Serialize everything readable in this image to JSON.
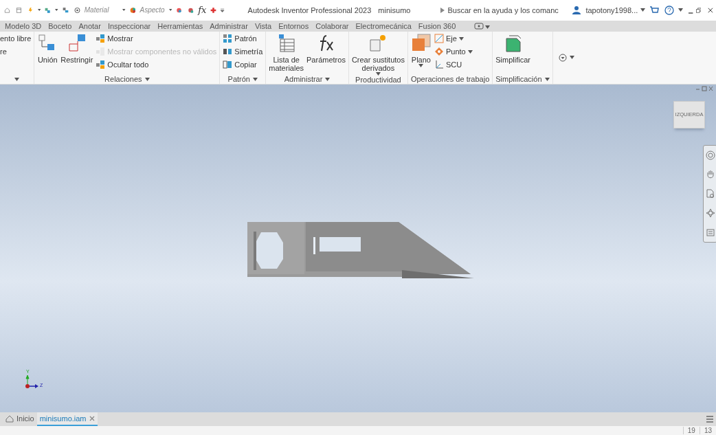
{
  "quick_access": {
    "material": "Material",
    "appearance": "Aspecto",
    "formula": "fx"
  },
  "window": {
    "title": "Autodesk Inventor Professional 2023",
    "document": "minisumo",
    "search": {
      "placeholder": "Buscar en la ayuda y los comanc"
    },
    "user": "tapotony1998..."
  },
  "ribbon_tabs": [
    {
      "label": "Modelo 3D"
    },
    {
      "label": "Boceto"
    },
    {
      "label": "Anotar"
    },
    {
      "label": "Inspeccionar"
    },
    {
      "label": "Herramientas"
    },
    {
      "label": "Administrar"
    },
    {
      "label": "Vista"
    },
    {
      "label": "Entornos"
    },
    {
      "label": "Colaborar"
    },
    {
      "label": "Electromecánica"
    },
    {
      "label": "Fusion 360"
    }
  ],
  "ribbon_panels": [
    {
      "menu": true,
      "commands": [
        {
          "kind": "small",
          "label": "ento libre",
          "disabled": false,
          "dropdown": false
        },
        {
          "kind": "small",
          "label": "re",
          "disabled": false,
          "dropdown": false
        }
      ]
    },
    {
      "label": "Relaciones",
      "menu": true,
      "commands": [
        {
          "kind": "large",
          "label": "Unión",
          "disabled": false,
          "dropdown": false
        },
        {
          "kind": "large",
          "label": "Restringir",
          "disabled": false,
          "dropdown": false
        },
        {
          "kind": "small",
          "label": "Mostrar",
          "disabled": false,
          "dropdown": false
        },
        {
          "kind": "small",
          "label": "Mostrar componentes no válidos",
          "disabled": true,
          "dropdown": false
        },
        {
          "kind": "small",
          "label": "Ocultar todo",
          "disabled": false,
          "dropdown": false
        }
      ]
    },
    {
      "label": "Patrón",
      "menu": true,
      "commands": [
        {
          "kind": "small",
          "label": "Patrón",
          "disabled": false,
          "dropdown": false
        },
        {
          "kind": "small",
          "label": "Simetría",
          "disabled": false,
          "dropdown": false
        },
        {
          "kind": "small",
          "label": "Copiar",
          "disabled": false,
          "dropdown": false
        }
      ]
    },
    {
      "label": "Administrar",
      "menu": true,
      "commands": [
        {
          "kind": "large",
          "label": "Lista de\nmateriales",
          "disabled": false,
          "dropdown": false
        },
        {
          "kind": "large",
          "label": "Parámetros",
          "disabled": false,
          "dropdown": false
        }
      ]
    },
    {
      "label": "Productividad",
      "menu": false,
      "commands": [
        {
          "kind": "large",
          "label": "Crear sustitutos\nderivados",
          "disabled": false,
          "dropdown": true
        }
      ]
    },
    {
      "label": "Operaciones de trabajo",
      "menu": false,
      "commands": [
        {
          "kind": "large",
          "label": "Plano",
          "disabled": false,
          "dropdown": true
        },
        {
          "kind": "small",
          "label": "Eje",
          "disabled": false,
          "dropdown": true
        },
        {
          "kind": "small",
          "label": "Punto",
          "disabled": false,
          "dropdown": true
        },
        {
          "kind": "small",
          "label": "SCU",
          "disabled": false,
          "dropdown": false
        }
      ]
    },
    {
      "label": "Simplificación",
      "menu": true,
      "commands": [
        {
          "kind": "large",
          "label": "Simplificar",
          "disabled": false,
          "dropdown": false
        }
      ]
    }
  ],
  "viewport": {
    "view_cube": "IZQUIERDA",
    "axes": {
      "y": "Y",
      "z": "Z"
    }
  },
  "document_tabs": [
    {
      "label": "Inicio",
      "kind": "home",
      "selected": false
    },
    {
      "label": "minisumo.iam",
      "kind": "document",
      "selected": true
    }
  ],
  "status_bar": [
    "19",
    "13"
  ]
}
